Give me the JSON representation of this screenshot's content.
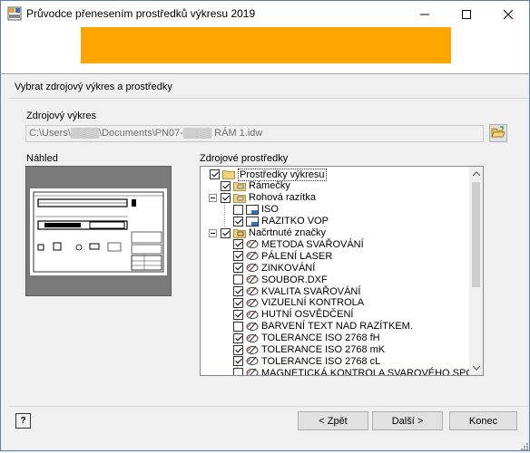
{
  "window": {
    "title": "Průvodce přenesením prostředků výkresu 2019",
    "min_glyph": "—",
    "max_glyph": "☐",
    "close_glyph": "✕"
  },
  "banner": {
    "color": "#ffa500"
  },
  "step": {
    "label": "Vybrat zdrojový výkres a prostředky"
  },
  "source": {
    "label": "Zdrojový výkres",
    "path": "C:\\Users\\▒▒▒▒\\Documents\\PN07-▒▒▒▒ RÁM 1.idw"
  },
  "preview": {
    "label": "Náhled"
  },
  "resources": {
    "label": "Zdrojové prostředky",
    "items": [
      {
        "label": "Prostředky výkresu",
        "checked": true,
        "icon": "folder-icon"
      },
      {
        "label": "Rámečky",
        "checked": true,
        "icon": "frame-folder-icon"
      },
      {
        "label": "Rohová razítka",
        "checked": true,
        "icon": "titleblock-folder-icon"
      },
      {
        "label": "ISO",
        "checked": false,
        "icon": "titleblock-icon"
      },
      {
        "label": "RAZITKO VOP",
        "checked": true,
        "icon": "titleblock-icon"
      },
      {
        "label": "Načrtnuté značky",
        "checked": true,
        "icon": "symbol-folder-icon"
      },
      {
        "label": "METODA SVAŘOVÁNÍ",
        "checked": true,
        "icon": "sketched-symbol-icon"
      },
      {
        "label": "PÁLENÍ LASER",
        "checked": true,
        "icon": "sketched-symbol-icon"
      },
      {
        "label": "ZINKOVÁNÍ",
        "checked": true,
        "icon": "sketched-symbol-icon"
      },
      {
        "label": "SOUBOR.DXF",
        "checked": false,
        "icon": "sketched-symbol-icon"
      },
      {
        "label": "KVALITA SVAŘOVÁNÍ",
        "checked": true,
        "icon": "sketched-symbol-icon"
      },
      {
        "label": "VIZUELNÍ KONTROLA",
        "checked": true,
        "icon": "sketched-symbol-icon"
      },
      {
        "label": "HUTNÍ OSVĚDČENÍ",
        "checked": true,
        "icon": "sketched-symbol-icon"
      },
      {
        "label": "BARVENÍ TEXT NAD RAZÍTKEM.",
        "checked": false,
        "icon": "sketched-symbol-icon"
      },
      {
        "label": "TOLERANCE ISO 2768 fH",
        "checked": true,
        "icon": "sketched-symbol-icon"
      },
      {
        "label": "TOLERANCE ISO 2768 mK",
        "checked": true,
        "icon": "sketched-symbol-icon"
      },
      {
        "label": "TOLERANCE ISO 2768 cL",
        "checked": true,
        "icon": "sketched-symbol-icon"
      },
      {
        "label": "MAGNETICKÁ KONTROLA SVAROVÉHO SPOJE",
        "checked": false,
        "icon": "sketched-symbol-icon"
      }
    ]
  },
  "buttons": {
    "help": "?",
    "back": "< Zpět",
    "next": "Další >",
    "finish": "Konec"
  }
}
